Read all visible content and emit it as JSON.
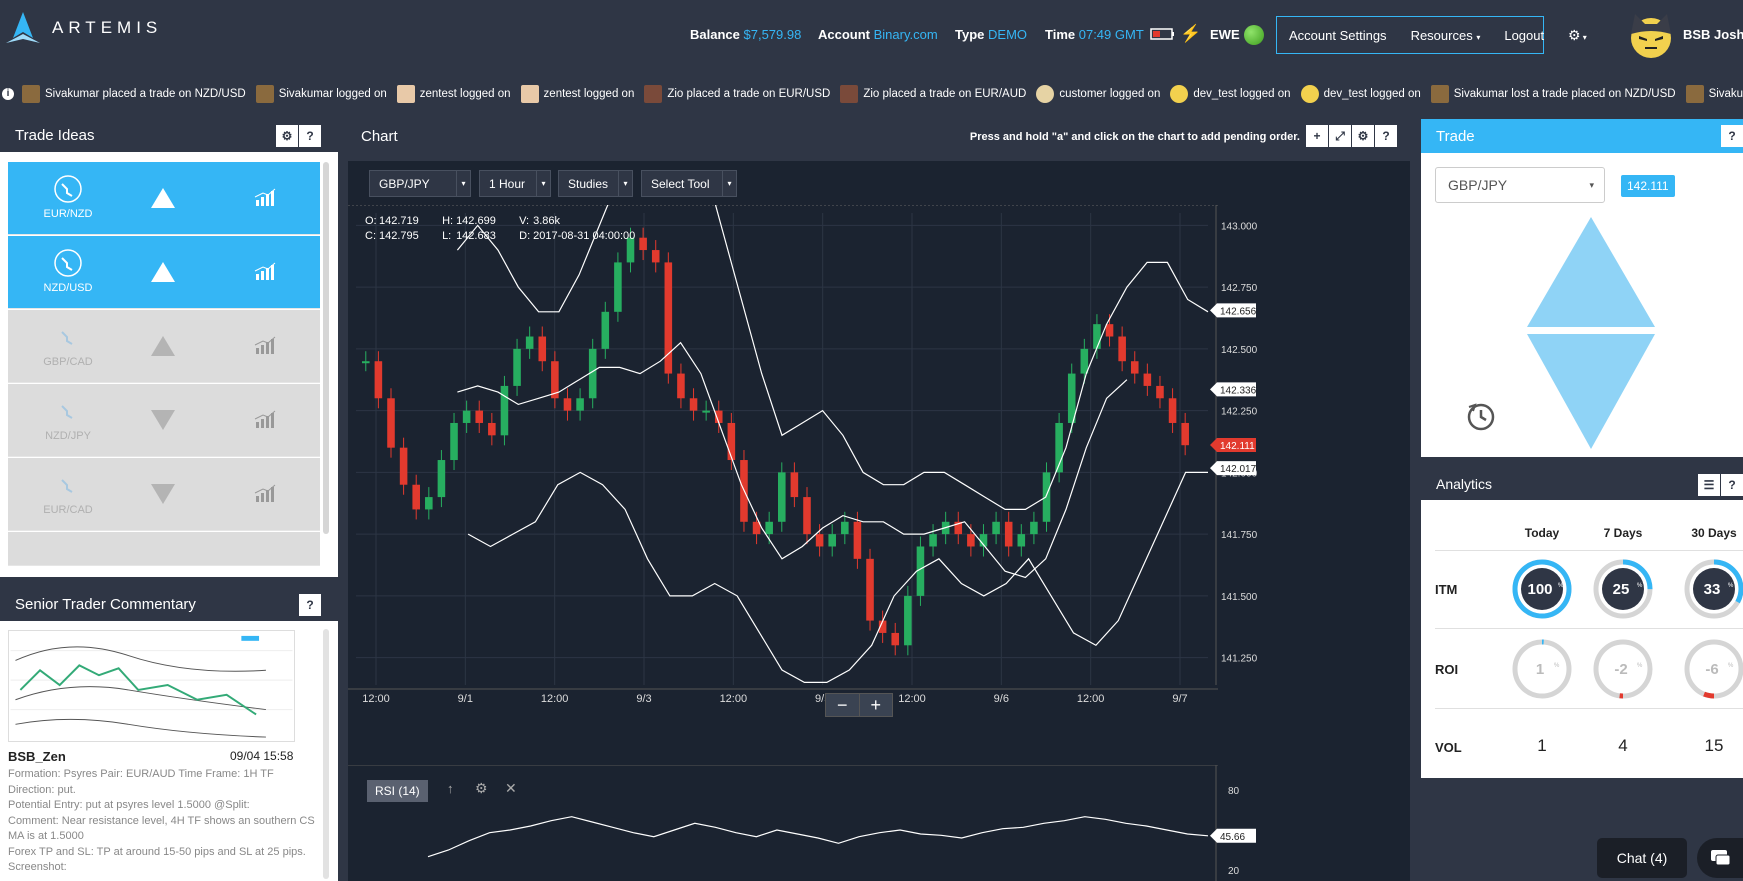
{
  "app": {
    "name": "ARTEMIS"
  },
  "header": {
    "balance_label": "Balance",
    "balance_value": "$7,579.98",
    "account_label": "Account",
    "account_value": "Binary.com",
    "type_label": "Type",
    "type_value": "DEMO",
    "time_label": "Time",
    "time_value": "07:49 GMT",
    "ewe_label": "EWE",
    "account_settings": "Account Settings",
    "resources": "Resources",
    "logout": "Logout",
    "username": "BSB Josh"
  },
  "ticker": [
    "Sivakumar placed a trade on NZD/USD",
    "Sivakumar logged on",
    "zentest logged on",
    "zentest logged on",
    "Zio placed a trade on EUR/USD",
    "Zio placed a trade on EUR/AUD",
    "customer logged on",
    "dev_test logged on",
    "dev_test logged on",
    "Sivakumar lost a trade placed on NZD/USD",
    "Sivakumar"
  ],
  "trade_ideas": {
    "title": "Trade Ideas",
    "help": "?",
    "items": [
      {
        "pair": "EUR/NZD",
        "direction": "up",
        "state": "active"
      },
      {
        "pair": "NZD/USD",
        "direction": "up",
        "state": "active"
      },
      {
        "pair": "GBP/CAD",
        "direction": "up",
        "state": "inactive"
      },
      {
        "pair": "NZD/JPY",
        "direction": "down",
        "state": "inactive"
      },
      {
        "pair": "EUR/CAD",
        "direction": "down",
        "state": "inactive"
      }
    ]
  },
  "commentary": {
    "title": "Senior Trader Commentary",
    "help": "?",
    "author": "BSB_Zen",
    "date": "09/04 15:58",
    "lines": [
      "Formation: Psyres  Pair: EUR/AUD  Time Frame: 1H  TF",
      "Direction: put.",
      "Potential Entry: put at psyres level 1.5000 @Split:",
      "Comment: Near resistance level, 4H TF shows an southern CS",
      "MA is at 1.5000",
      "Forex TP and SL: TP at around 15-50 pips and SL at 25 pips.",
      "Screenshot:"
    ]
  },
  "chart": {
    "title": "Chart",
    "hint": "Press and hold \"a\" and click on the chart to add pending order.",
    "pair": "GBP/JPY",
    "interval": "1 Hour",
    "studies": "Studies",
    "tool": "Select Tool",
    "ohlc": {
      "o_label": "O:",
      "o": "142.719",
      "h_label": "H:",
      "h": "142.699",
      "v_label": "V:",
      "v": "3.86k",
      "c_label": "C:",
      "c": "142.795",
      "l_label": "L:",
      "l": "142.683",
      "d_label": "D:",
      "d": "2017-08-31 04:00:00"
    },
    "rsi_label": "RSI (14)",
    "rsi_value": "45.66",
    "rsi_ticks": [
      "80",
      "20"
    ]
  },
  "chart_data": {
    "type": "line",
    "title": "",
    "y_ticks": [
      "143.000",
      "142.750",
      "142.500",
      "142.250",
      "142.000",
      "141.750",
      "141.500",
      "141.250"
    ],
    "x_ticks": [
      "12:00",
      "9/1",
      "12:00",
      "9/3",
      "12:00",
      "9/5",
      "12:00",
      "9/6",
      "12:00",
      "9/7"
    ],
    "ylim": [
      141.2,
      143.05
    ],
    "price_labels": [
      "142.656",
      "142.336",
      "142.111",
      "142.017"
    ],
    "last_price": "142.111",
    "grid": true,
    "close_series": [
      142.45,
      142.3,
      142.1,
      141.95,
      141.85,
      141.9,
      142.05,
      142.2,
      142.25,
      142.2,
      142.15,
      142.35,
      142.5,
      142.55,
      142.45,
      142.3,
      142.25,
      142.3,
      142.5,
      142.65,
      142.85,
      142.95,
      142.9,
      142.85,
      142.4,
      142.3,
      142.25,
      142.25,
      142.2,
      142.05,
      141.8,
      141.75,
      141.8,
      142.0,
      141.9,
      141.75,
      141.7,
      141.75,
      141.8,
      141.65,
      141.4,
      141.35,
      141.3,
      141.5,
      141.7,
      141.75,
      141.8,
      141.75,
      141.7,
      141.75,
      141.8,
      141.7,
      141.75,
      141.8,
      142.0,
      142.2,
      142.4,
      142.5,
      142.6,
      142.55,
      142.45,
      142.4,
      142.35,
      142.3,
      142.2,
      142.11
    ],
    "upper_band": [
      null,
      null,
      null,
      null,
      null,
      142.9,
      143.0,
      142.9,
      142.75,
      142.65,
      142.65,
      142.8,
      143.0,
      143.2,
      143.3,
      143.4,
      143.5,
      143.3,
      143.0,
      142.7,
      142.4,
      142.15,
      142.2,
      142.25,
      142.15,
      142.0,
      141.95,
      141.95,
      142.0,
      142.0,
      141.95,
      141.9,
      141.85,
      141.85,
      141.9,
      142.1,
      142.4,
      142.6,
      142.75,
      142.85,
      142.85,
      142.7,
      142.65
    ],
    "lower_band": [
      null,
      null,
      null,
      null,
      null,
      141.75,
      141.7,
      141.75,
      141.8,
      141.95,
      142.0,
      141.95,
      141.85,
      141.65,
      141.5,
      141.5,
      141.55,
      141.5,
      141.35,
      141.2,
      141.15,
      141.15,
      141.2,
      141.3,
      141.5,
      141.6,
      141.65,
      141.55,
      141.5,
      141.55,
      141.65,
      141.5,
      141.35,
      141.3,
      141.4,
      141.6,
      141.8,
      142.0,
      142.0
    ],
    "rsi": [
      30,
      35,
      42,
      48,
      50,
      53,
      57,
      60,
      56,
      52,
      48,
      45,
      50,
      55,
      52,
      48,
      45,
      50,
      47,
      44,
      40,
      45,
      48,
      50,
      47,
      46,
      44,
      48,
      51,
      52,
      55,
      57,
      60,
      58,
      55,
      53,
      50,
      47,
      45.66
    ]
  },
  "trade": {
    "title": "Trade",
    "help": "?",
    "pair": "GBP/JPY",
    "price": "142.111"
  },
  "analytics": {
    "title": "Analytics",
    "help": "?",
    "columns": [
      "Today",
      "7 Days",
      "30 Days"
    ],
    "rows": {
      "itm": "ITM",
      "roi": "ROI",
      "vol": "VOL"
    },
    "itm": [
      "100",
      "25",
      "33"
    ],
    "itm_fraction": [
      1.0,
      0.25,
      0.33
    ],
    "roi": [
      "1",
      "-2",
      "-6"
    ],
    "vol": [
      "1",
      "4",
      "15"
    ],
    "pct": "%"
  },
  "chat": {
    "label": "Chat (4)"
  },
  "colors": {
    "accent": "#35b6f5",
    "up": "#27ae60",
    "down": "#e23a2e",
    "panel": "#2f3645"
  }
}
